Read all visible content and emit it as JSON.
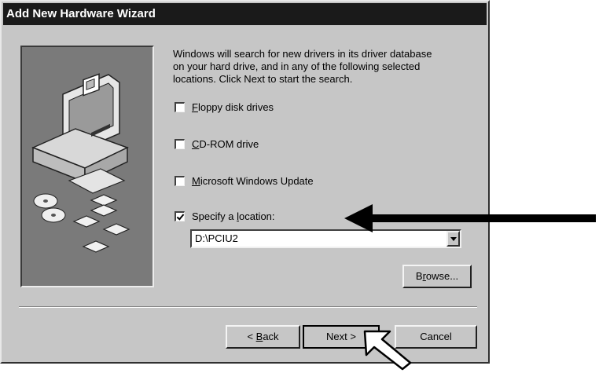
{
  "window": {
    "title": "Add New Hardware Wizard"
  },
  "description": "Windows will search for new drivers in its driver database\non your hard drive, and in any of the following selected\nlocations. Click Next to start the search.",
  "options": [
    {
      "mnemonic": "F",
      "rest": "loppy disk drives",
      "checked": false
    },
    {
      "mnemonic": "C",
      "rest": "D-ROM drive",
      "checked": false
    },
    {
      "mnemonic": "M",
      "rest": "icrosoft Windows Update",
      "checked": false
    },
    {
      "prefix": "Specify a ",
      "mnemonic": "l",
      "rest": "ocation:",
      "checked": true
    }
  ],
  "location": {
    "value": "D:\\PCIU2"
  },
  "buttons": {
    "browse": {
      "prefix": "B",
      "mnemonic": "r",
      "rest": "owse..."
    },
    "back": {
      "prefix": "< ",
      "mnemonic": "B",
      "rest": "ack"
    },
    "next": {
      "label": "Next >"
    },
    "cancel": {
      "label": "Cancel"
    }
  },
  "icons": [
    "computer-illustration",
    "cd-discs",
    "floppy-disks",
    "annotation-arrow",
    "mouse-cursor-icon"
  ],
  "colors": {
    "titlebar": "#1a1a1a",
    "dialog": "#c6c6c6",
    "panel": "#7a7a7a"
  }
}
